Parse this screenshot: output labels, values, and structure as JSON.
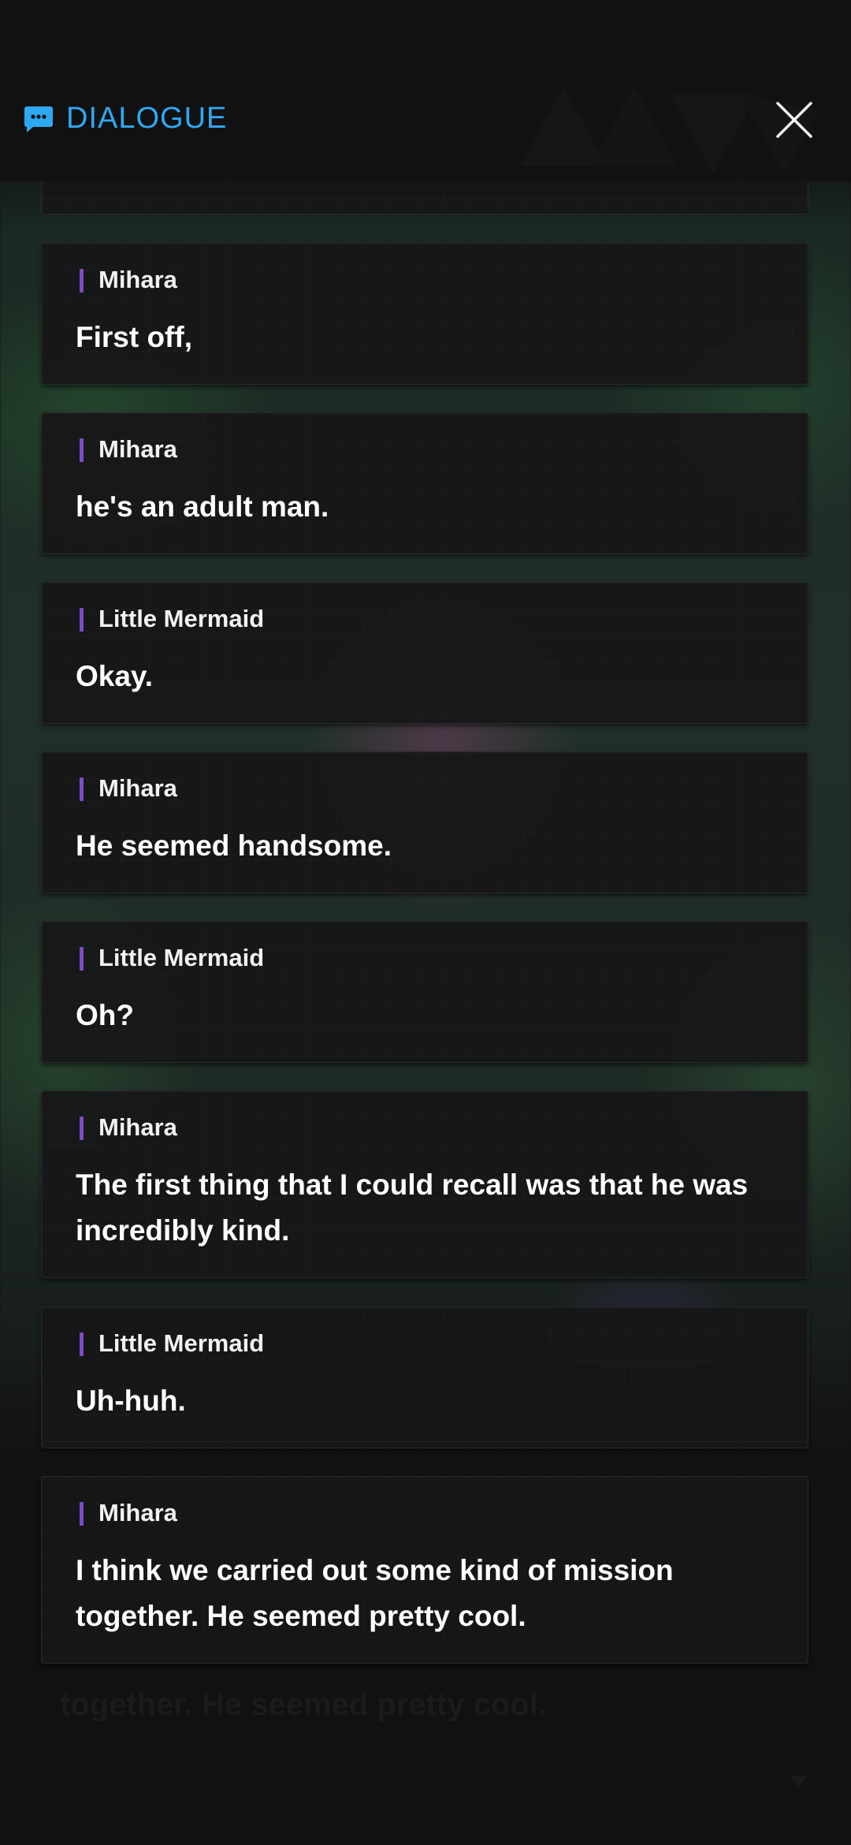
{
  "header": {
    "title": "DIALOGUE",
    "icon": "chat-bubble-icon",
    "close_icon": "close-icon",
    "accent_color": "#2ea8f2"
  },
  "dialogue": [
    {
      "speaker": "Mihara",
      "text": "First off,"
    },
    {
      "speaker": "Mihara",
      "text": "he's an adult man."
    },
    {
      "speaker": "Little Mermaid",
      "text": "Okay."
    },
    {
      "speaker": "Mihara",
      "text": "He seemed handsome."
    },
    {
      "speaker": "Little Mermaid",
      "text": "Oh?"
    },
    {
      "speaker": "Mihara",
      "text": "The first thing that I could recall was that he was incredibly kind."
    },
    {
      "speaker": "Little Mermaid",
      "text": "Uh-huh."
    },
    {
      "speaker": "Mihara",
      "text": "I think we carried out some kind of mission together. He seemed pretty cool."
    }
  ],
  "background_subtitle": "together. He seemed pretty cool.",
  "speaker_marker_color": "#7a4cc9"
}
